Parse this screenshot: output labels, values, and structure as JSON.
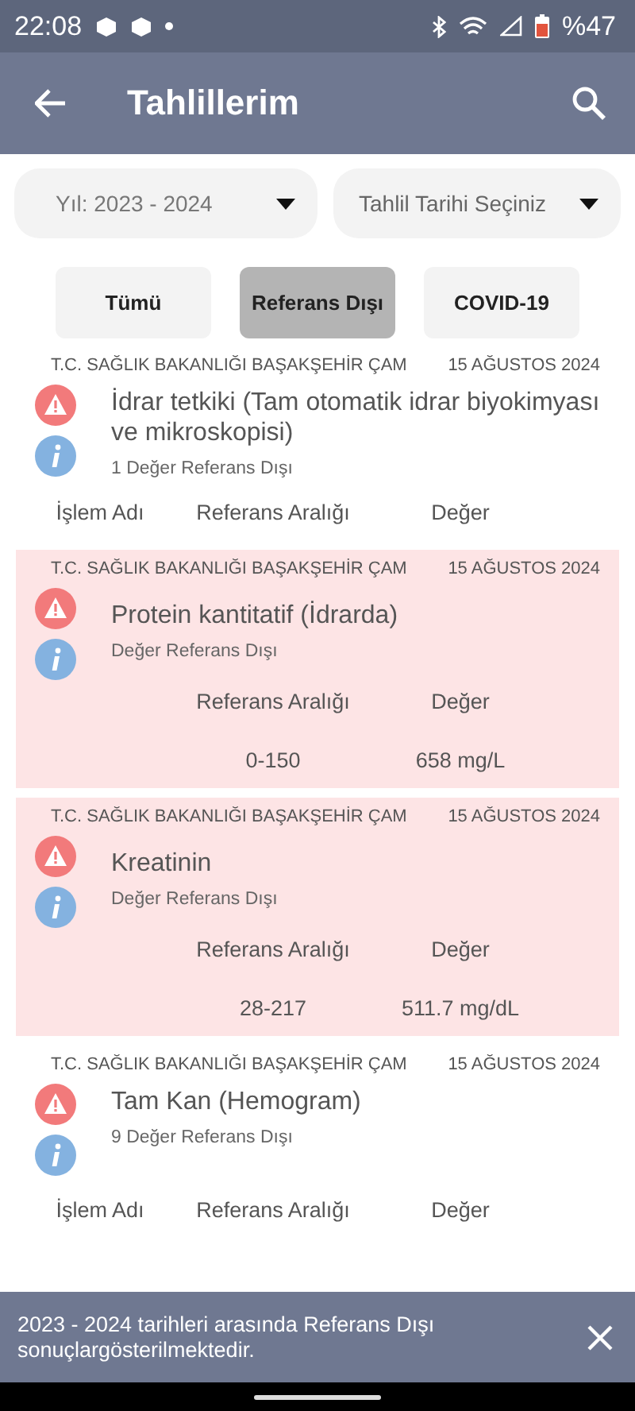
{
  "status_bar": {
    "time": "22:08",
    "battery": "%47"
  },
  "app_bar": {
    "title": "Tahlillerim"
  },
  "filters": [
    {
      "label": "Yıl: 2023 - 2024",
      "kind": "value"
    },
    {
      "label": "Tahlil Tarihi Seçiniz",
      "kind": "placeholder"
    }
  ],
  "tabs": [
    {
      "label": "Tümü",
      "selected": false
    },
    {
      "label": "Referans Dışı",
      "selected": true
    },
    {
      "label": "COVID-19",
      "selected": false
    }
  ],
  "results": [
    {
      "kind": "summary",
      "hospital": "T.C. SAĞLIK BAKANLIĞI BAŞAKŞEHİR ÇAM",
      "date": "15 AĞUSTOS 2024",
      "title": "İdrar tetkiki (Tam otomatik idrar biyokimyası ve mikroskopisi)",
      "note": "1 Değer Referans Dışı",
      "columns": [
        "İşlem Adı",
        "Referans Aralığı",
        "Değer"
      ]
    },
    {
      "kind": "detail",
      "hospital": "T.C. SAĞLIK BAKANLIĞI BAŞAKŞEHİR ÇAM",
      "date": "15 AĞUSTOS 2024",
      "title": "Protein kantitatif (İdrarda)",
      "note": "Değer Referans Dışı",
      "columns": [
        "Referans Aralığı",
        "Değer"
      ],
      "values": [
        "0-150",
        "658 mg/L"
      ]
    },
    {
      "kind": "detail",
      "hospital": "T.C. SAĞLIK BAKANLIĞI BAŞAKŞEHİR ÇAM",
      "date": "15 AĞUSTOS 2024",
      "title": "Kreatinin",
      "note": "Değer Referans Dışı",
      "columns": [
        "Referans Aralığı",
        "Değer"
      ],
      "values": [
        "28-217",
        "511.7 mg/dL"
      ]
    },
    {
      "kind": "summary",
      "hospital": "T.C. SAĞLIK BAKANLIĞI BAŞAKŞEHİR ÇAM",
      "date": "15 AĞUSTOS 2024",
      "title": "Tam Kan (Hemogram)",
      "note": "9 Değer Referans Dışı",
      "columns": [
        "İşlem Adı",
        "Referans Aralığı",
        "Değer"
      ]
    }
  ],
  "snackbar": {
    "message": "2023 - 2024 tarihleri arasında Referans Dışı sonuçlargösterilmektedir."
  }
}
